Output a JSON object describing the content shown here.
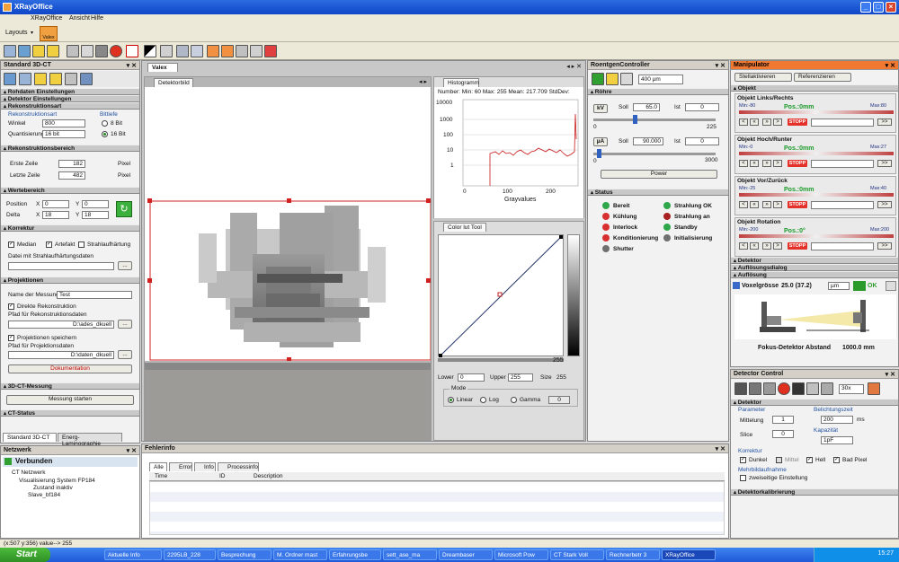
{
  "app": {
    "title": "XRayOffice",
    "minimize": "_",
    "maximize": "□",
    "close": "×"
  },
  "menu": [
    "XRayOffice",
    "Ansicht",
    "Hilfe"
  ],
  "toolbar": {
    "layouts": "Layouts",
    "valex": "Valex"
  },
  "left": {
    "title": "Standard 3D-CT",
    "sections": {
      "rohdaten": "Rohdaten Einstellungen",
      "detektor": "Detektor Einstellungen",
      "rekonstruktion": "Rekonstruktionsart",
      "fenster": "Rekonstruktionsbereich",
      "roi": "Wertebereich",
      "korrektur": "Korrektur",
      "projektionen": "Projektionen",
      "ct_messung": "3D-CT-Messung",
      "ct_status": "CT-Status"
    },
    "rekon": {
      "group": "Rekonstruktionsart",
      "winkel_label": "Winkel",
      "winkel": "800",
      "quantisierung_label": "Quantisierung",
      "quantisierung": "16 bit",
      "bittiefe_label": "Bittiefe",
      "opt8": "8 Bit",
      "opt16": "16 Bit"
    },
    "zeilen": {
      "erste_label": "Erste Zeile",
      "erste": "182",
      "letzte_label": "Letzte Zeile",
      "letzte": "482",
      "unit": "Pixel"
    },
    "pos": {
      "position_label": "Position",
      "delta_label": "Delta",
      "x": "0",
      "y": "0",
      "dx": "18",
      "dy": "18"
    },
    "korr": {
      "median": "Median",
      "artefakt": "Artefakt",
      "strahlaufhaertung": "Strahlaufhärtung",
      "datei_label": "Datei mit Strahlaufhärtungsdaten"
    },
    "proj": {
      "name_label": "Name der Messung",
      "name": "Test",
      "direkt": "Direkte Rekonstruktion",
      "pfad_rekon_label": "Pfad für Rekonstruktionsdaten",
      "pfad_rekon": "D:\\ades_dkuell",
      "projektionen": "Projektionen speichern",
      "pfad_proj_label": "Pfad für Projektionsdaten",
      "pfad_proj": "D:\\daten_dkuell",
      "browse": "...",
      "doku": "Dokumentation"
    },
    "messung_starten": "Messung starten",
    "bottom_tabs": [
      "Standard 3D-CT",
      "Energ-Laminographie"
    ]
  },
  "network": {
    "title": "Netzwerk",
    "status": "Verbunden",
    "tree": [
      "CT Netzwerk",
      "Visualisierung System FP184",
      "Zustand inaktiv",
      "Slave_bf184"
    ]
  },
  "center": {
    "doc_tab": "Valex",
    "detector_tab": "Detektorbild",
    "histogram": {
      "tab": "Histogramm",
      "stats": "Number: Min: 60 Max: 255 Mean: 217.709 StdDev:",
      "xlabel": "Grayvalues",
      "yticks": [
        "10000",
        "1000",
        "100",
        "10",
        "1"
      ],
      "xticks": [
        "0",
        "100",
        "200"
      ]
    },
    "colortab": {
      "tab": "Color lut Tool",
      "max": "255",
      "lower_label": "Lower",
      "lower": "0",
      "upper_label": "Upper",
      "upper": "255",
      "size_label": "Size",
      "size": "255",
      "mode_label": "Mode",
      "modes": [
        "Linear",
        "Log",
        "Gamma"
      ],
      "gamma": "0"
    }
  },
  "fehler": {
    "title": "Fehlerinfo",
    "tabs": [
      "Alle",
      "Error",
      "Info",
      "Processinfo"
    ],
    "columns": [
      "Time",
      "ID",
      "Description"
    ]
  },
  "roentgen": {
    "title": "RoentgenController",
    "voxel": "400 µm",
    "section": "Röhre",
    "soll1_label": "Soll",
    "soll1": "65.0",
    "ist1_label": "Ist",
    "ist1": "0",
    "unit1": "kV",
    "tick1": "225",
    "zero1": "0",
    "soll2_label": "Soll",
    "soll2": "90.000",
    "ist2_label": "Ist",
    "ist2": "0",
    "unit2": "µA",
    "tick2": "3000",
    "zero2": "0",
    "power": "Power",
    "status_section": "Status",
    "status": [
      {
        "label": "Bereit",
        "color": "#2ea64a"
      },
      {
        "label": "Kühlung",
        "color": "#d83030"
      },
      {
        "label": "Interlock",
        "color": "#d83030"
      },
      {
        "label": "Konditionierung",
        "color": "#d83030"
      },
      {
        "label": "Shutter",
        "color": "#707070"
      },
      {
        "label": "Strahlung OK",
        "color": "#2ea64a"
      },
      {
        "label": "Strahlung an",
        "color": "#a82020"
      },
      {
        "label": "Standby",
        "color": "#2ea64a"
      },
      {
        "label": "Initialisierung",
        "color": "#707070"
      }
    ]
  },
  "manip": {
    "title": "Manipulator",
    "buttons": [
      "Stellaktivieren",
      "Referenzieren"
    ],
    "objekt": "Objekt",
    "axes": [
      {
        "name": "Objekt Links/Rechts",
        "min": "Min:-80",
        "max": "Max:80",
        "pos": "Pos.:0mm"
      },
      {
        "name": "Objekt Hoch/Runter",
        "min": "Min:-0",
        "max": "Max:27",
        "pos": "Pos.:0mm"
      },
      {
        "name": "Objekt Vor/Zurück",
        "min": "Min:-25",
        "max": "Max:40",
        "pos": "Pos.:0mm"
      },
      {
        "name": "Objekt Rotation",
        "min": "Min:-200",
        "max": "Max:200",
        "pos": "Pos.:0°"
      }
    ],
    "stop": "STOPP",
    "go": ">>",
    "detektor": "Detektor",
    "aufloesung": "Auflösungsdialog",
    "aufloesung2": "Auflösung",
    "voxel_label": "Voxelgrösse",
    "voxel": "25.0 (37.2)",
    "voxel_unit": "µm",
    "ok": "OK",
    "fdd_label": "Fokus-Detektor Abstand",
    "fdd": "1000.0 mm"
  },
  "detctl": {
    "title": "Detector Control",
    "binning": "30x",
    "section": "Detektor",
    "parameter": "Parameter",
    "mittelung_label": "Mittelung",
    "mittelung": "1",
    "slice_label": "Slice",
    "slice": "0",
    "belichtung_label": "Belichtungszeit",
    "belichtung": "200",
    "belichtung_unit": "ms",
    "kapazitaet_label": "Kapazität",
    "kapazitaet": "1pF",
    "korrektur_label": "Korrektur",
    "dunkel": "Dunkel",
    "mittel": "Mittel",
    "hell": "Hell",
    "bad": "Bad Pixel",
    "mehrbild": "Mehrbildaufnahme",
    "zweiseitig": "zweiseitige Einstellung",
    "kalib": "Detektorkalibrierung"
  },
  "statusbar": {
    "text": "(x:507 y:356) value--> 255"
  },
  "taskbar": {
    "start": "Start",
    "tasks": [
      "Aktuelle Info",
      "2295LB_228",
      "Besprechung",
      "M. Ordner mast",
      "Erfahrungsbe",
      "sett_ase_ma",
      "Dreambaser",
      "Microsoft Pow",
      "CT Stark Voll",
      "Rechnerbetr 3",
      "XRayOffice"
    ],
    "time": "15:27"
  }
}
